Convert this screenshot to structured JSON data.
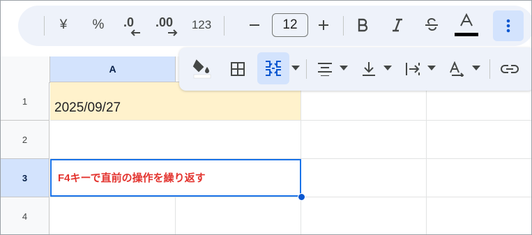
{
  "toolbar": {
    "currency_label": "¥",
    "percent_label": "%",
    "decrease_decimal_label": ".0",
    "increase_decimal_label": ".00",
    "number_format_label": "123",
    "font_size": "12",
    "text_color": "#000000"
  },
  "sheet": {
    "columns": [
      {
        "label": "A"
      }
    ],
    "rows": [
      "1",
      "2",
      "3",
      "4"
    ],
    "cells": {
      "A1": "2025/09/27",
      "A3": "F4キーで直前の操作を繰り返す"
    },
    "date_fill_color": "#fff2cc",
    "emphasis_text_color": "#e3342f",
    "selected_cell": "A3"
  }
}
